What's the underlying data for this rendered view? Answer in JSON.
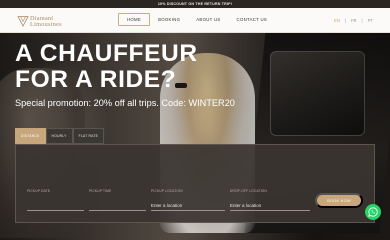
{
  "announcement": "10% DISCOUNT ON THE RETURN TRIP!",
  "brand": {
    "line1": "Diamant",
    "line2": "Limousines",
    "color": "#a9895f"
  },
  "nav": [
    {
      "label": "HOME",
      "active": true
    },
    {
      "label": "BOOKING",
      "active": false
    },
    {
      "label": "ABOUT US",
      "active": false
    },
    {
      "label": "CONTACT US",
      "active": false
    }
  ],
  "languages": [
    "EN",
    "FR",
    "PT"
  ],
  "hero": {
    "headline_line1": "A CHAUFFEUR",
    "headline_line2": "FOR A RIDE?",
    "promotion": "Special promotion: 20% off all trips. Code: WINTER20"
  },
  "booking": {
    "tabs": [
      "DISTANCE",
      "HOURLY",
      "FLAT RATE"
    ],
    "active_tab": "DISTANCE",
    "fields": [
      {
        "label": "PICKUP DATE",
        "value": ""
      },
      {
        "label": "PICKUP TIME",
        "value": ""
      },
      {
        "label": "PICKUP LOCATION",
        "value": "",
        "placeholder": "Enter a location"
      },
      {
        "label": "DROP-OFF LOCATION",
        "value": "",
        "placeholder": "Enter a location"
      }
    ],
    "submit_label": "BOOK NOW"
  },
  "colors": {
    "accent": "#c9a77d",
    "whatsapp": "#25d366",
    "topbar": "#2b2622"
  },
  "icons": {
    "logo": "diamond-logo-icon",
    "chat": "whatsapp-icon"
  }
}
